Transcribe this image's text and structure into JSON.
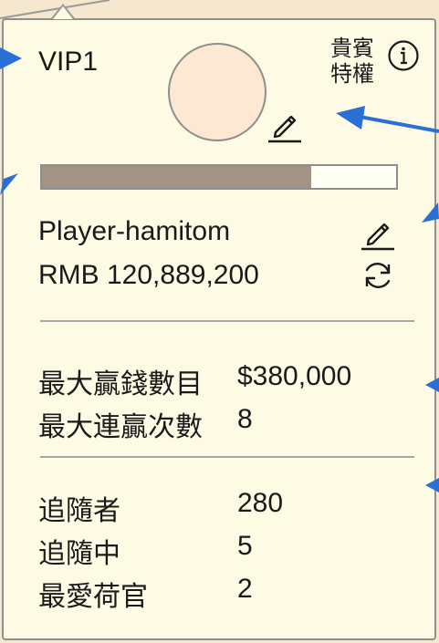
{
  "profile": {
    "vip_level": "VIP1",
    "vip_privilege": "貴賓特權",
    "player_name": "Player-hamitom",
    "balance": "RMB 120,889,200",
    "progress_fraction": 0.76
  },
  "stats_max": [
    {
      "label": "最大贏錢數目",
      "value": "$380,000"
    },
    {
      "label": "最大連贏次數",
      "value": "8"
    }
  ],
  "stats_social": [
    {
      "label": "追隨者",
      "value": "280"
    },
    {
      "label": "追隨中",
      "value": "5"
    },
    {
      "label": "最愛荷官",
      "value": "2"
    }
  ],
  "icons": {
    "info": "info-icon",
    "edit": "pencil-icon",
    "refresh": "refresh-icon"
  },
  "colors": {
    "panel_bg": "#fdfbe3",
    "page_bg": "#f6e8cf",
    "progress_fill": "#a39384",
    "avatar_fill": "#fde8d4",
    "annotation_arrow": "#2a6fd6"
  }
}
